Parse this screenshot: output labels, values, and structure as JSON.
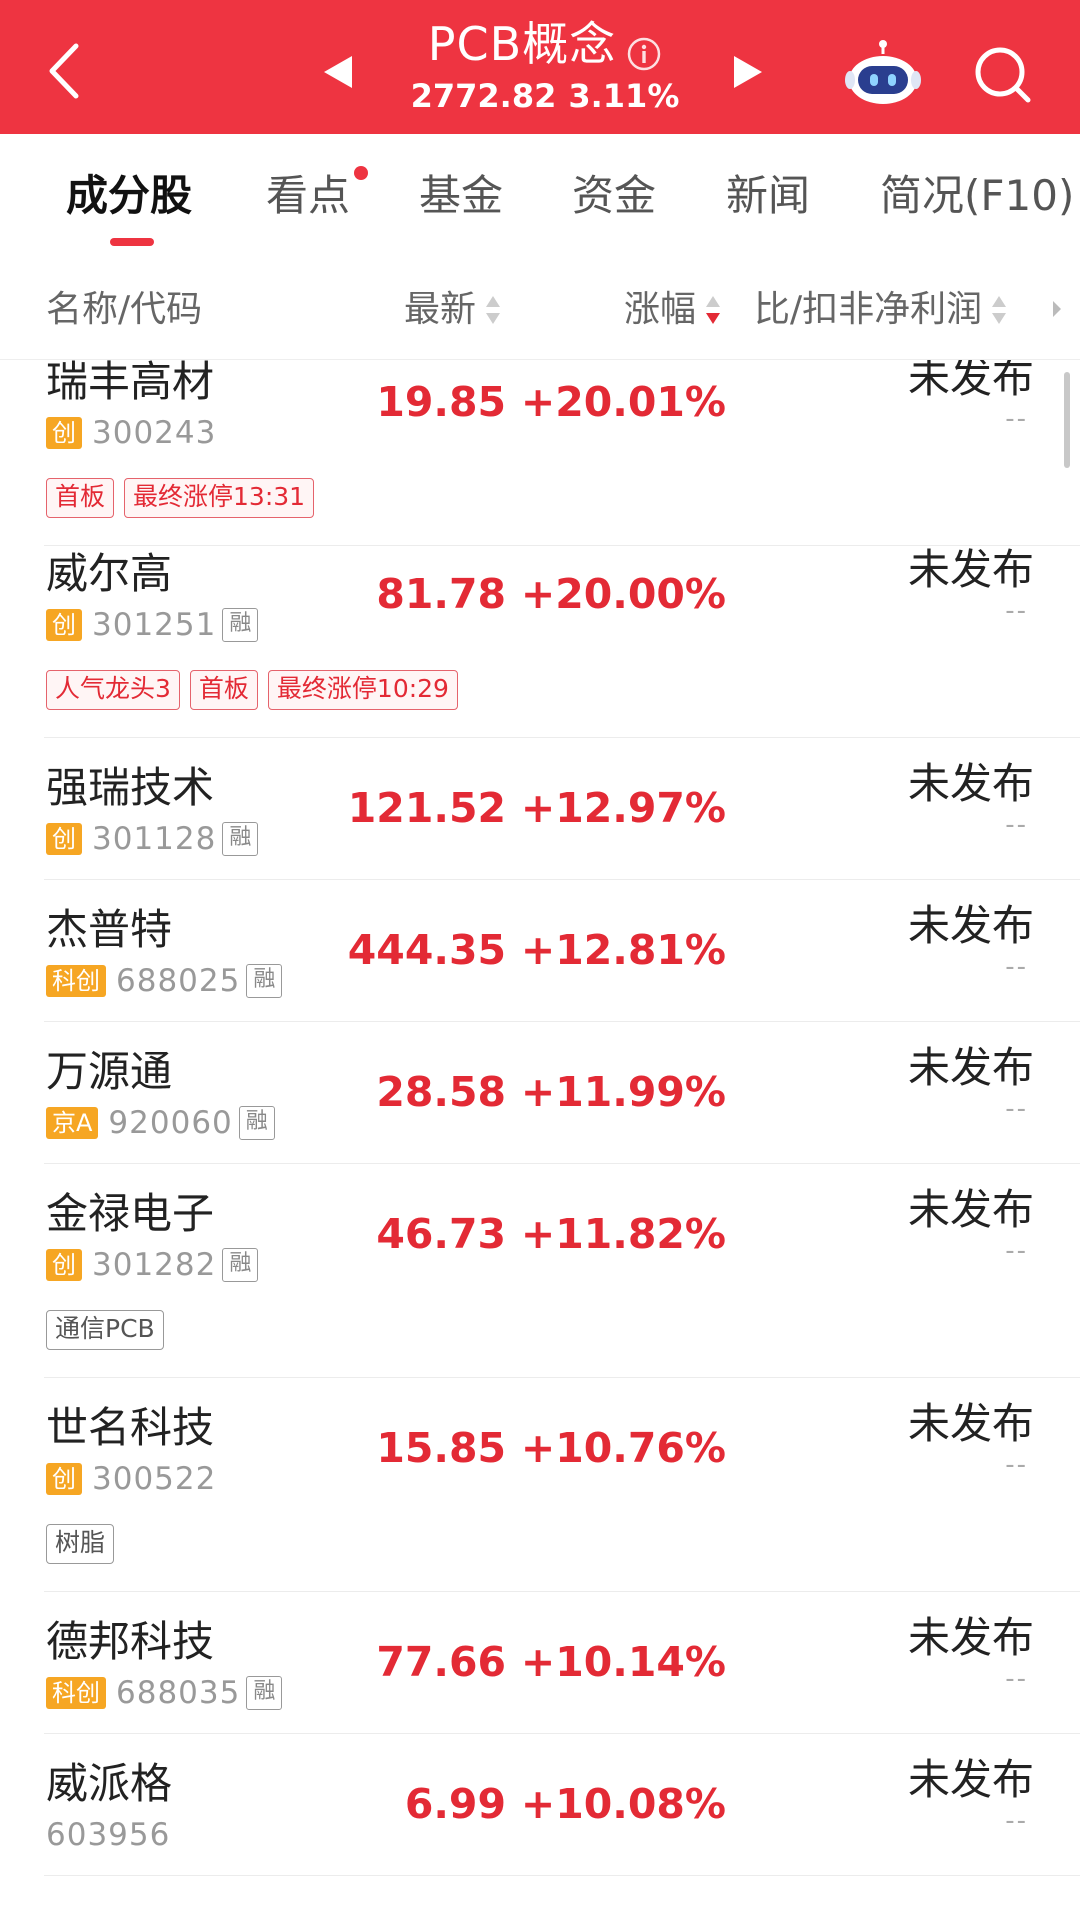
{
  "header": {
    "title": "PCB概念",
    "index_value": "2772.82",
    "index_change": "3.11%"
  },
  "tabs": [
    {
      "label": "成分股",
      "active": true
    },
    {
      "label": "看点",
      "has_dot": true
    },
    {
      "label": "基金"
    },
    {
      "label": "资金"
    },
    {
      "label": "新闻"
    },
    {
      "label": "简况(F10)"
    }
  ],
  "columns": {
    "name": "名称/代码",
    "latest": "最新",
    "change": "涨幅",
    "profit": "比/扣非净利润"
  },
  "colors": {
    "accent": "#ee3441",
    "up": "#e32a35",
    "board": "#f6a623"
  },
  "rows": [
    {
      "name": "瑞丰高材",
      "board": "创",
      "code": "300243",
      "rong": "",
      "price": "19.85",
      "change": "+20.01%",
      "profit": "未发布",
      "profit_sub": "--",
      "tags": [
        {
          "text": "首板",
          "style": "red"
        },
        {
          "text": "最终涨停13:31",
          "style": "red"
        }
      ]
    },
    {
      "name": "威尔高",
      "board": "创",
      "code": "301251",
      "rong": "融",
      "price": "81.78",
      "change": "+20.00%",
      "profit": "未发布",
      "profit_sub": "--",
      "tags": [
        {
          "text": "人气龙头3",
          "style": "red"
        },
        {
          "text": "首板",
          "style": "red"
        },
        {
          "text": "最终涨停10:29",
          "style": "red"
        }
      ]
    },
    {
      "name": "强瑞技术",
      "board": "创",
      "code": "301128",
      "rong": "融",
      "price": "121.52",
      "change": "+12.97%",
      "profit": "未发布",
      "profit_sub": "--",
      "tags": []
    },
    {
      "name": "杰普特",
      "board": "科创",
      "code": "688025",
      "rong": "融",
      "price": "444.35",
      "change": "+12.81%",
      "profit": "未发布",
      "profit_sub": "--",
      "tags": []
    },
    {
      "name": "万源通",
      "board": "京A",
      "code": "920060",
      "rong": "融",
      "price": "28.58",
      "change": "+11.99%",
      "profit": "未发布",
      "profit_sub": "--",
      "tags": []
    },
    {
      "name": "金禄电子",
      "board": "创",
      "code": "301282",
      "rong": "融",
      "price": "46.73",
      "change": "+11.82%",
      "profit": "未发布",
      "profit_sub": "--",
      "tags": [
        {
          "text": "通信PCB",
          "style": "grey"
        }
      ]
    },
    {
      "name": "世名科技",
      "board": "创",
      "code": "300522",
      "rong": "",
      "price": "15.85",
      "change": "+10.76%",
      "profit": "未发布",
      "profit_sub": "--",
      "tags": [
        {
          "text": "树脂",
          "style": "grey"
        }
      ]
    },
    {
      "name": "德邦科技",
      "board": "科创",
      "code": "688035",
      "rong": "融",
      "price": "77.66",
      "change": "+10.14%",
      "profit": "未发布",
      "profit_sub": "--",
      "tags": []
    },
    {
      "name": "威派格",
      "board": "",
      "code": "603956",
      "rong": "",
      "price": "6.99",
      "change": "+10.08%",
      "profit": "未发布",
      "profit_sub": "--",
      "tags": []
    }
  ]
}
